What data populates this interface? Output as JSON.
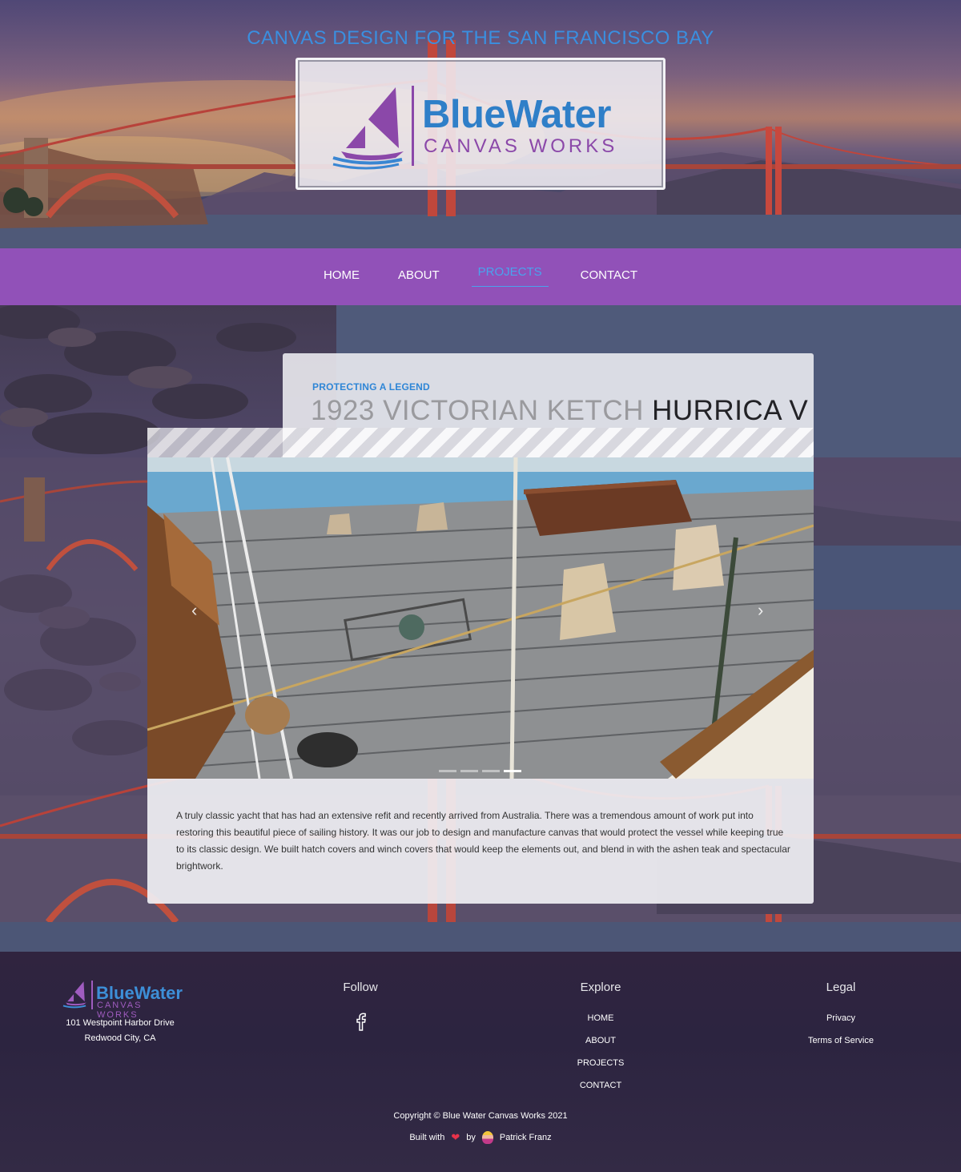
{
  "hero": {
    "tagline": "CANVAS DESIGN FOR THE SAN FRANCISCO BAY",
    "logo_main": "BlueWater",
    "logo_sub": "CANVAS WORKS"
  },
  "nav": {
    "items": [
      {
        "label": "HOME",
        "active": false
      },
      {
        "label": "ABOUT",
        "active": false
      },
      {
        "label": "PROJECTS",
        "active": true
      },
      {
        "label": "CONTACT",
        "active": false
      }
    ]
  },
  "project": {
    "kicker": "PROTECTING A LEGEND",
    "headline_light": "1923 VICTORIAN KETCH",
    "headline_dark": "HURRICA V",
    "description": "A truly classic yacht that has had an extensive refit and recently arrived from Australia. There was a tremendous amount of work put into restoring this beautiful piece of sailing history. It was our job to design and manufacture canvas that would protect the vessel while keeping true to its classic design. We built hatch covers and winch covers that would keep the elements out, and blend in with the ashen teak and spectacular brightwork.",
    "carousel": {
      "prev_icon": "chevron-left-icon",
      "next_icon": "chevron-right-icon",
      "slide_count": 4,
      "active_slide": 4
    }
  },
  "footer": {
    "logo_main": "BlueWater",
    "logo_sub": "CANVAS WORKS",
    "address_line1": "101 Westpoint Harbor Drive",
    "address_line2": "Redwood City, CA",
    "follow_title": "Follow",
    "follow_icon": "facebook-icon",
    "explore_title": "Explore",
    "explore_links": [
      "HOME",
      "ABOUT",
      "PROJECTS",
      "CONTACT"
    ],
    "legal_title": "Legal",
    "legal_links": [
      "Privacy",
      "Terms of Service"
    ],
    "copyright": "Copyright © Blue Water Canvas Works 2021",
    "built_with": "Built with",
    "by": "by",
    "author": "Patrick Franz"
  },
  "colors": {
    "nav_bg": "#9151b8",
    "accent_blue": "#2f86d6",
    "brand_purple": "#8b48a9"
  }
}
